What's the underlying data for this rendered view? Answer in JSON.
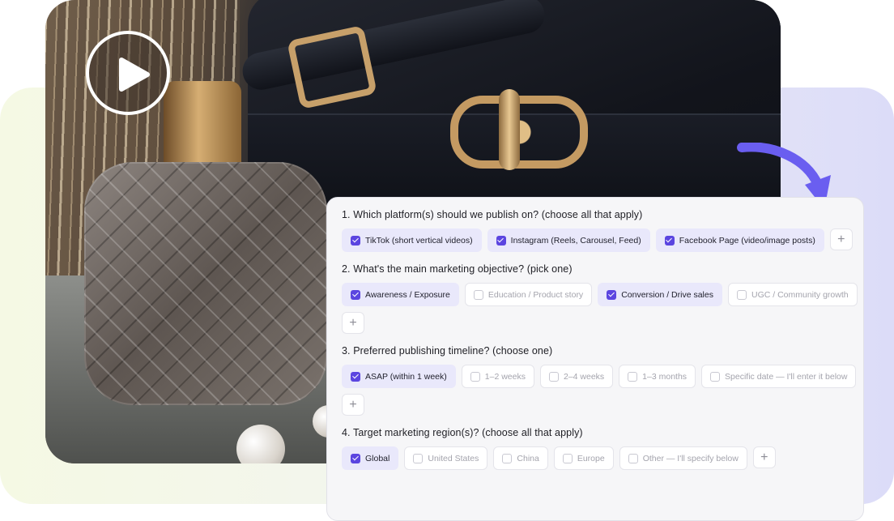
{
  "questions": [
    {
      "title": "1. Which platform(s) should we publish on? (choose all that apply)",
      "options": [
        {
          "label": "TikTok (short vertical videos)",
          "checked": true
        },
        {
          "label": "Instagram (Reels, Carousel, Feed)",
          "checked": true
        },
        {
          "label": "Facebook Page (video/image posts)",
          "checked": true
        }
      ]
    },
    {
      "title": "2. What's the main marketing objective? (pick one)",
      "options": [
        {
          "label": "Awareness / Exposure",
          "checked": true
        },
        {
          "label": "Education / Product story",
          "checked": false
        },
        {
          "label": "Conversion / Drive sales",
          "checked": true
        },
        {
          "label": "UGC / Community growth",
          "checked": false
        }
      ]
    },
    {
      "title": "3. Preferred publishing timeline? (choose one)",
      "options": [
        {
          "label": "ASAP (within 1 week)",
          "checked": true
        },
        {
          "label": "1–2 weeks",
          "checked": false
        },
        {
          "label": "2–4 weeks",
          "checked": false
        },
        {
          "label": "1–3 months",
          "checked": false
        },
        {
          "label": "Specific date — I'll enter it below",
          "checked": false
        }
      ]
    },
    {
      "title": "4. Target marketing region(s)? (choose all that apply)",
      "options": [
        {
          "label": "Global",
          "checked": true
        },
        {
          "label": "United States",
          "checked": false
        },
        {
          "label": "China",
          "checked": false
        },
        {
          "label": "Europe",
          "checked": false
        },
        {
          "label": "Other — I'll specify below",
          "checked": false
        }
      ]
    }
  ],
  "add_button_label": "+",
  "colors": {
    "accent": "#5b45e0",
    "chip_selected_bg": "#e9e8fb",
    "arrow": "#6a5ef0"
  },
  "icons": {
    "play": "play-icon",
    "arrow": "curved-arrow-icon",
    "checkbox": "checkbox-icon",
    "add": "plus-icon"
  }
}
